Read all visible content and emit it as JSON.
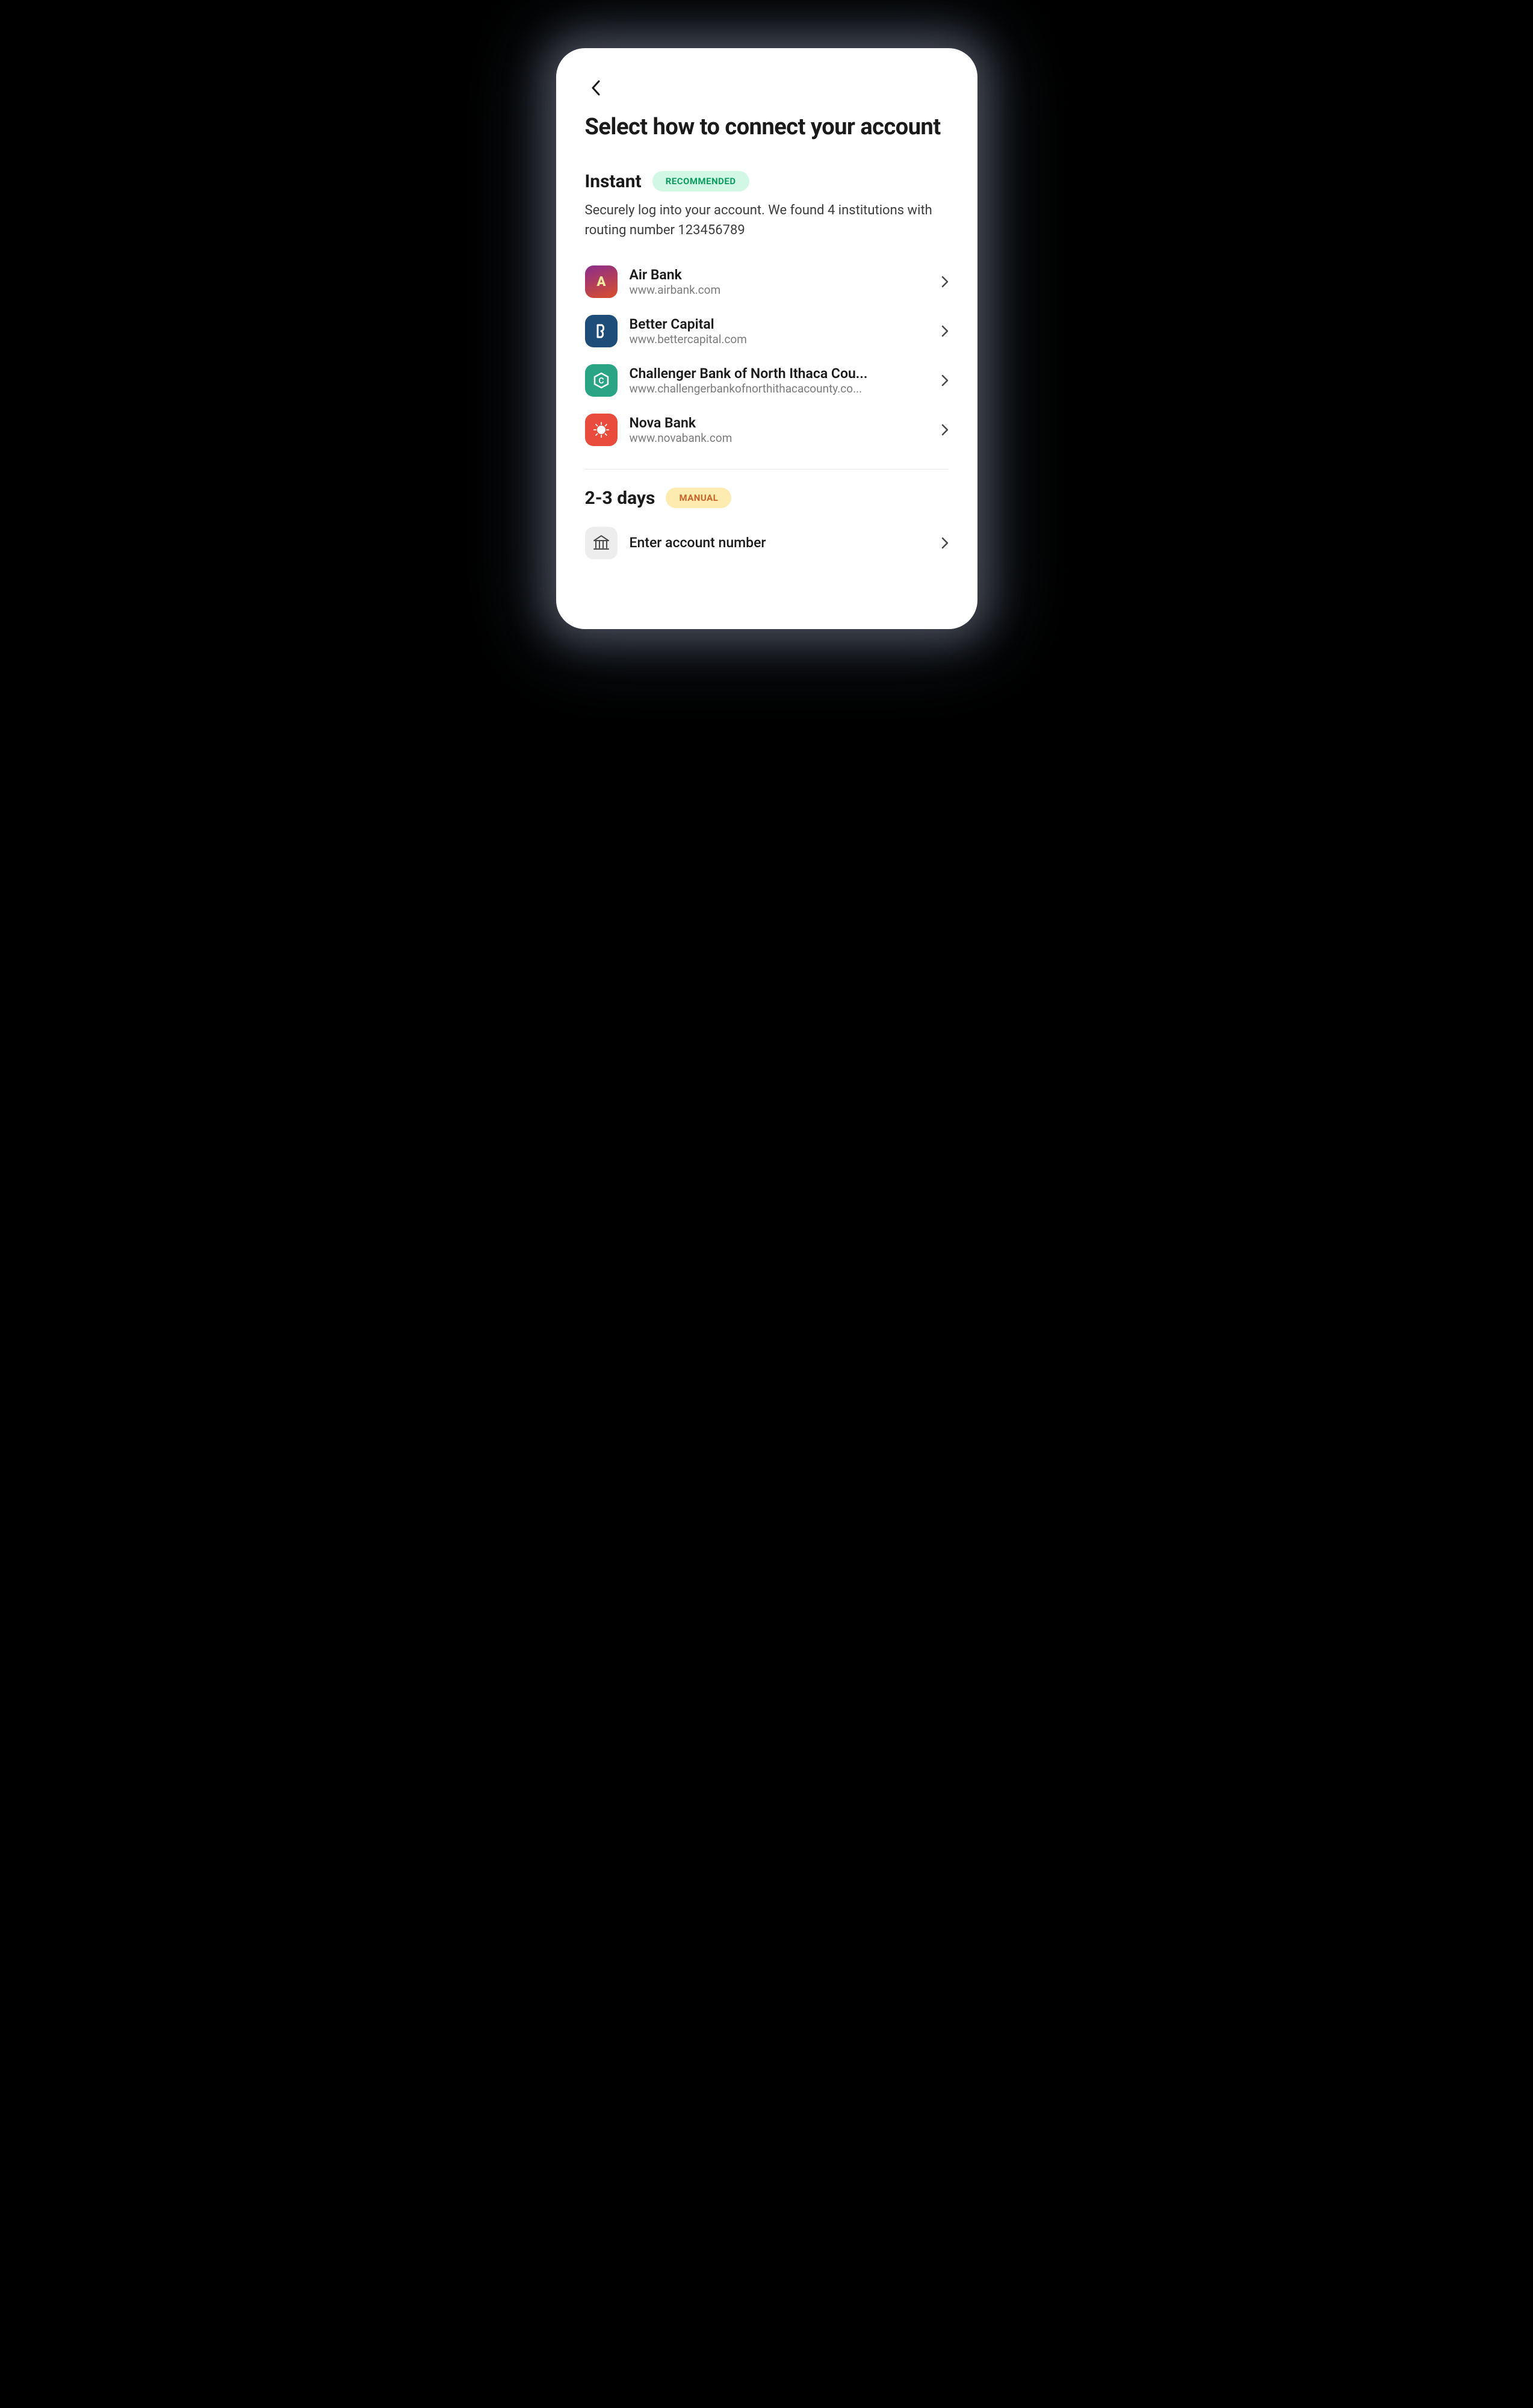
{
  "title": "Select how to connect your account",
  "instant": {
    "heading": "Instant",
    "badge": "RECOMMENDED",
    "description": "Securely log into your account. We found 4 institutions with routing number 123456789"
  },
  "institutions": [
    {
      "name": "Air Bank",
      "url": "www.airbank.com"
    },
    {
      "name": "Better Capital",
      "url": "www.bettercapital.com"
    },
    {
      "name": "Challenger Bank of North Ithaca Cou...",
      "url": "www.challengerbankofnorthithacacounty.co..."
    },
    {
      "name": "Nova Bank",
      "url": "www.novabank.com"
    }
  ],
  "manual": {
    "heading": "2-3 days",
    "badge": "MANUAL",
    "action": "Enter account number"
  }
}
